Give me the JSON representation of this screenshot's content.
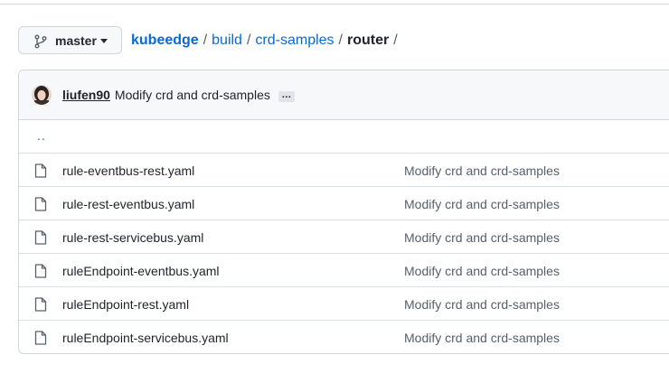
{
  "branch": {
    "label": "master",
    "icon": "git-branch-icon",
    "caret_icon": "triangle-down-icon"
  },
  "breadcrumb": {
    "root": "kubeedge",
    "segments": [
      "build",
      "crd-samples"
    ],
    "current": "router",
    "separator": "/"
  },
  "latest_commit": {
    "author": "liufen90",
    "message": "Modify crd and crd-samples",
    "ellipsis": "…",
    "avatar_icon": "user-avatar"
  },
  "parent_dir": "..",
  "files": [
    {
      "name": "rule-eventbus-rest.yaml",
      "commit": "Modify crd and crd-samples"
    },
    {
      "name": "rule-rest-eventbus.yaml",
      "commit": "Modify crd and crd-samples"
    },
    {
      "name": "rule-rest-servicebus.yaml",
      "commit": "Modify crd and crd-samples"
    },
    {
      "name": "ruleEndpoint-eventbus.yaml",
      "commit": "Modify crd and crd-samples"
    },
    {
      "name": "ruleEndpoint-rest.yaml",
      "commit": "Modify crd and crd-samples"
    },
    {
      "name": "ruleEndpoint-servicebus.yaml",
      "commit": "Modify crd and crd-samples"
    }
  ],
  "colors": {
    "link": "#0969da",
    "border": "#d0d7de",
    "header_bg": "#f6f8fa",
    "muted_text": "#57606a"
  }
}
